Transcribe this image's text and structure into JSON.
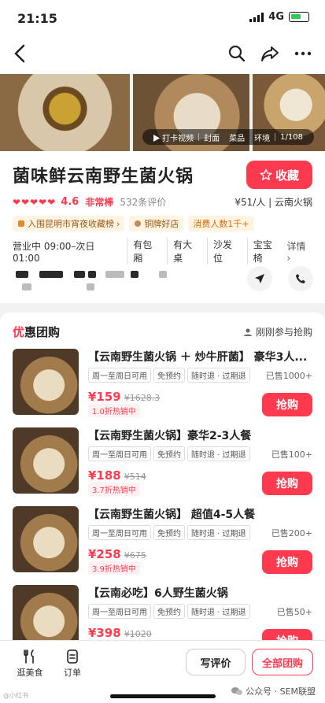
{
  "status_bar": {
    "time": "21:15",
    "network": "4G"
  },
  "gallery": {
    "video_label": "打卡视频",
    "tabs": [
      "封面",
      "菜品",
      "环境"
    ],
    "counter": "1/108"
  },
  "shop": {
    "name": "菌味鲜云南野生菌火锅",
    "favorite_label": "收藏",
    "hearts": "❤❤❤❤❤",
    "score": "4.6",
    "hot_label": "非常棒",
    "reviews": "532条评价",
    "price_category": "¥51/人 | 云南火锅",
    "badges": [
      "入围昆明市宵夜收藏榜",
      "铜牌好店",
      "消费人数1千+"
    ],
    "hours": "营业中 09:00–次日01:00",
    "facilities": [
      "有包厢",
      "有大桌",
      "沙发位",
      "宝宝椅"
    ],
    "details_label": "详情"
  },
  "deals": {
    "title_prefix": "优",
    "title_rest": "惠团购",
    "hint": "刚刚参与抢购",
    "items": [
      {
        "title": "【云南野生菌火锅 ＋ 炒牛肝菌】 豪华3人...",
        "tags": [
          "周一至周日可用",
          "免预约",
          "随时退 · 过期退"
        ],
        "sold": "已售1000+",
        "price": "¥159",
        "old": "¥1628.3",
        "discount": "1.0折热销中",
        "buy": "抢购"
      },
      {
        "title": "【云南野生菌火锅】豪华2-3人餐",
        "tags": [
          "周一至周日可用",
          "免预约",
          "随时退 · 过期退"
        ],
        "sold": "已售100+",
        "price": "¥188",
        "old": "¥514",
        "discount": "3.7折热销中",
        "buy": "抢购"
      },
      {
        "title": "【云南野生菌火锅】 超值4-5人餐",
        "tags": [
          "周一至周日可用",
          "免预约",
          "随时退 · 过期退"
        ],
        "sold": "已售200+",
        "price": "¥258",
        "old": "¥675",
        "discount": "3.9折热销中",
        "buy": "抢购"
      },
      {
        "title": "【云南必吃】6人野生菌火锅",
        "tags": [
          "周一至周日可用",
          "免预约",
          "随时退 · 过期退"
        ],
        "sold": "已售50+",
        "price": "¥398",
        "old": "¥1020",
        "discount": "",
        "buy": "抢购"
      }
    ]
  },
  "bottom_bar": {
    "tab1": "逛美食",
    "tab2": "订单",
    "review_btn": "写评价",
    "all_deals_btn": "全部团购",
    "watermark": "公众号 · SEM联盟",
    "watermark_left": "@小红书"
  }
}
